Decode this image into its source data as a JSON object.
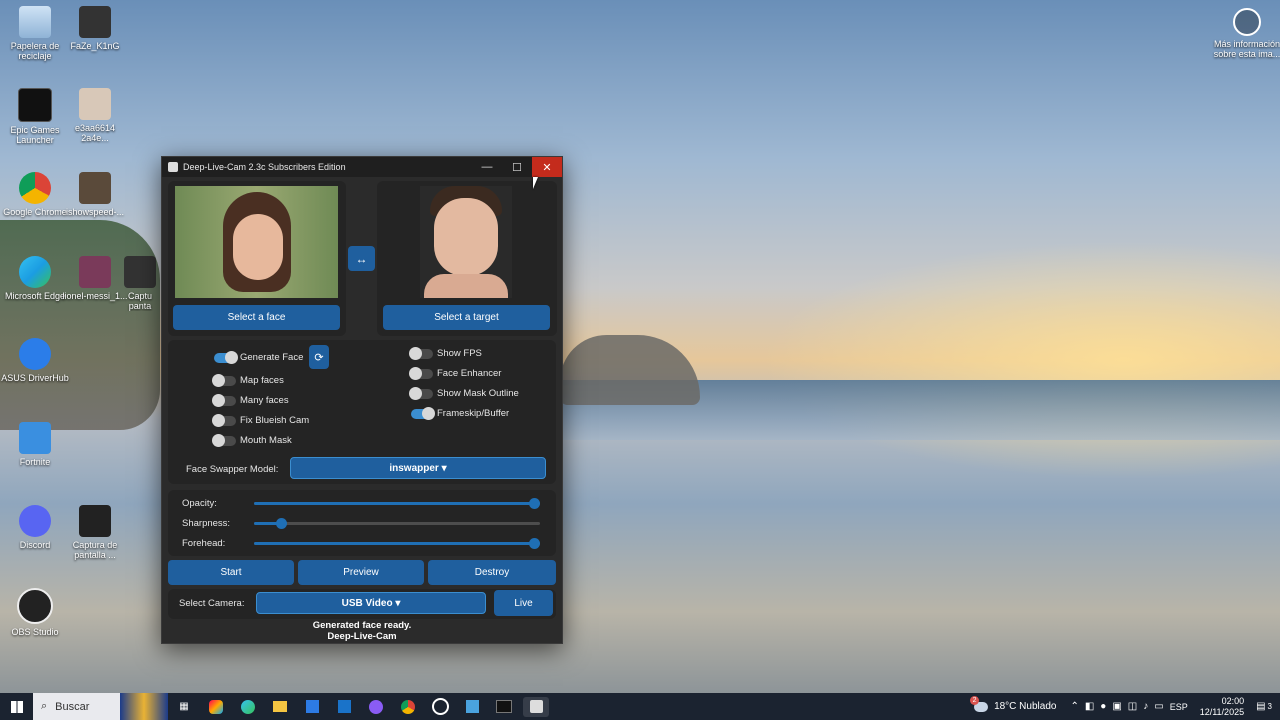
{
  "desktop": {
    "icons": [
      {
        "label": "Papelera de reciclaje",
        "icon": "recycle-bin-icon"
      },
      {
        "label": "FaZe_K1nG",
        "icon": "image-icon"
      },
      {
        "label": "Epic Games Launcher",
        "icon": "epic-games-icon"
      },
      {
        "label": "e3aa6614 2a4e...",
        "icon": "image-icon"
      },
      {
        "label": "Google Chrome",
        "icon": "chrome-icon"
      },
      {
        "label": "ishowspeed-...",
        "icon": "image-icon"
      },
      {
        "label": "Microsoft Edge",
        "icon": "edge-icon"
      },
      {
        "label": "lionel-messi_1...",
        "icon": "image-icon"
      },
      {
        "label": "Captu panta",
        "icon": "image-icon"
      },
      {
        "label": "ASUS DriverHub",
        "icon": "asus-icon"
      },
      {
        "label": "Fortnite",
        "icon": "fortnite-icon"
      },
      {
        "label": "Discord",
        "icon": "discord-icon"
      },
      {
        "label": "Captura de pantalla ...",
        "icon": "image-icon"
      },
      {
        "label": "OBS Studio",
        "icon": "obs-icon"
      }
    ],
    "info_widget": "Más información sobre esta ima..."
  },
  "window": {
    "title": "Deep-Live-Cam 2.3c Subscribers Edition",
    "minimize": "—",
    "maximize": "☐",
    "close": "✕",
    "select_face": "Select a face",
    "swap": "↔",
    "select_target": "Select a target",
    "toggles_left": [
      {
        "label": "Generate Face",
        "on": true
      },
      {
        "label": "Map faces",
        "on": false
      },
      {
        "label": "Many faces",
        "on": false
      },
      {
        "label": "Fix Blueish Cam",
        "on": false
      },
      {
        "label": "Mouth Mask",
        "on": false
      }
    ],
    "refresh_icon": "⟳",
    "toggles_right": [
      {
        "label": "Show FPS",
        "on": false
      },
      {
        "label": "Face Enhancer",
        "on": false
      },
      {
        "label": "Show Mask Outline",
        "on": false
      },
      {
        "label": "Frameskip/Buffer",
        "on": true
      }
    ],
    "model_label": "Face Swapper Model:",
    "model_value": "inswapper ▾",
    "sliders": [
      {
        "label": "Opacity:",
        "value": 1.0
      },
      {
        "label": "Sharpness:",
        "value": 0.08
      },
      {
        "label": "Forehead:",
        "value": 1.0
      }
    ],
    "start": "Start",
    "preview": "Preview",
    "destroy": "Destroy",
    "camera_label": "Select Camera:",
    "camera_value": "USB Video ▾",
    "live": "Live",
    "status_line1": "Generated face ready.",
    "status_line2": "Deep-Live-Cam"
  },
  "taskbar": {
    "search": "Buscar",
    "weather_badge": "2",
    "weather": "18°C Nublado",
    "lang": "ESP",
    "time": "02:00",
    "date": "12/11/2025",
    "notif_count": "3"
  },
  "colors": {
    "accent": "#1f5f9e",
    "window_bg": "#2b2b2b",
    "close_red": "#c42b1c"
  }
}
